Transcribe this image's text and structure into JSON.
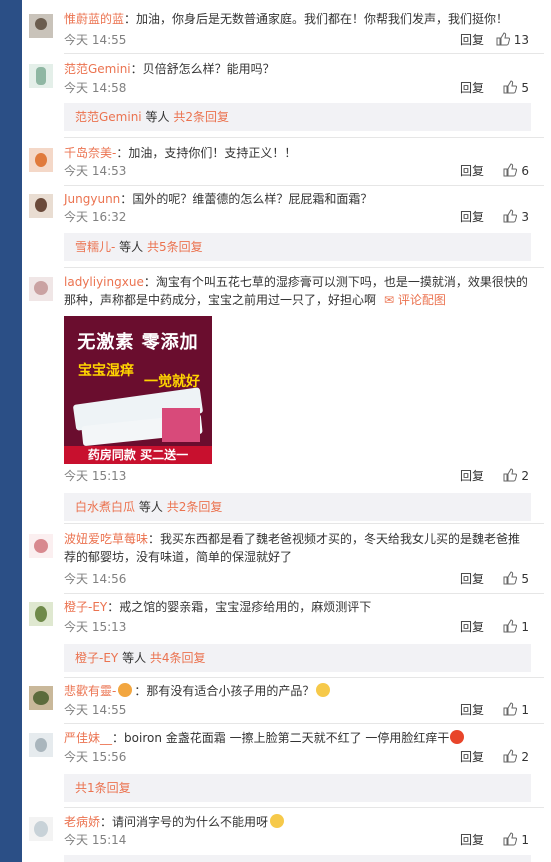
{
  "reply_label": "回复",
  "comments": [
    {
      "user": "惟蔚蓝的蓝",
      "text": "加油，你身后是无数普通家庭。我们都在！你帮我们发声，我们挺你！",
      "time": "今天 14:55",
      "likes": "13"
    },
    {
      "user": "范范Gemini",
      "text": "贝倍舒怎么样？能用吗？",
      "time": "今天 14:58",
      "likes": "5",
      "sub": {
        "users": "范范Gemini",
        "mid": "等人",
        "more": "共2条回复"
      }
    },
    {
      "user": "千岛奈美-",
      "text": "加油，支持你们！支持正义！！",
      "time": "今天 14:53",
      "likes": "6"
    },
    {
      "user": "Jungyunn",
      "text": "国外的呢？维蕾德的怎么样？屁屁霜和面霜？",
      "time": "今天 16:32",
      "likes": "3",
      "sub": {
        "users": "雪糯儿-",
        "mid": "等人",
        "more": "共5条回复"
      }
    },
    {
      "user": "ladyliyingxue",
      "text": "淘宝有个叫五花七草的湿疹膏可以测下吗，也是一摸就消，效果很快的那种，声称都是中药成分，宝宝之前用过一只了，好担心啊",
      "link": "评论配图",
      "time": "今天 15:13",
      "likes": "2",
      "sub": {
        "users": "白水煮白瓜",
        "mid": "等人",
        "more": "共2条回复"
      },
      "image": {
        "line1": "无激素 零添加",
        "line2": "宝宝湿痒",
        "line3": "一觉就好",
        "banner": "药房同款 买二送一"
      }
    },
    {
      "user": "波妞爱吃草莓味",
      "text": "我买东西都是看了魏老爸视频才买的，冬天给我女儿买的是魏老爸推荐的郁婴坊，没有味道，简单的保湿就好了",
      "time": "今天 14:56",
      "likes": "5"
    },
    {
      "user": "橙子-EY",
      "text": "戒之馆的婴亲霜，宝宝湿疹给用的，麻烦测评下",
      "time": "今天 15:13",
      "likes": "1",
      "sub": {
        "users": "橙子-EY",
        "mid": "等人",
        "more": "共4条回复"
      }
    },
    {
      "user": "悲歡有靈-",
      "text": "那有没有适合小孩子用的产品？",
      "time": "今天 14:55",
      "likes": "1"
    },
    {
      "user": "严佳妹__",
      "text": "boiron 金盏花面霜 一擦上脸第二天就不红了 一停用脸红痒干",
      "time": "今天 15:56",
      "likes": "2",
      "sub": {
        "users": "",
        "mid": "",
        "more": "共1条回复"
      }
    },
    {
      "user": "老病娇",
      "text": "请问消字号的为什么不能用呀",
      "time": "今天 15:14",
      "likes": "1"
    }
  ],
  "colors": {
    "accent": "#eb7350",
    "page_bg": "#2b4f86"
  }
}
